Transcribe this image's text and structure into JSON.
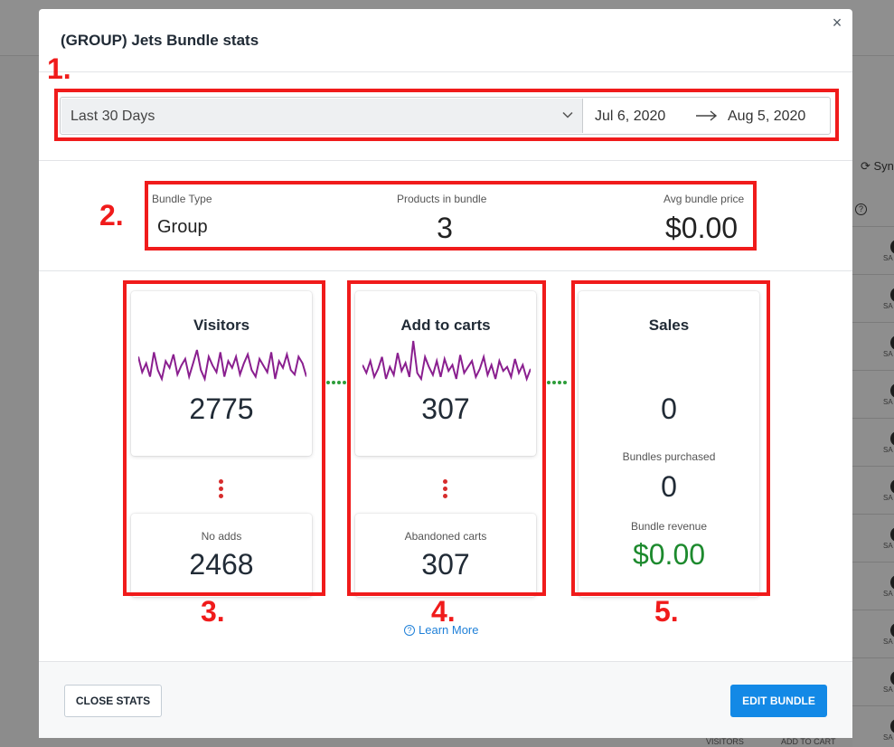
{
  "modal": {
    "title": "(GROUP) Jets Bundle stats",
    "close_glyph": "×"
  },
  "date_range": {
    "preset": "Last 30 Days",
    "start": "Jul 6, 2020",
    "end": "Aug 5, 2020"
  },
  "bundle_info": {
    "type_label": "Bundle Type",
    "type_value": "Group",
    "products_label": "Products in bundle",
    "products_value": "3",
    "price_label": "Avg bundle price",
    "price_value": "$0.00"
  },
  "funnel": {
    "visitors": {
      "title": "Visitors",
      "value": "2775",
      "sub_label": "No adds",
      "sub_value": "2468"
    },
    "add_to_carts": {
      "title": "Add to carts",
      "value": "307",
      "sub_label": "Abandoned carts",
      "sub_value": "307"
    },
    "sales": {
      "title": "Sales",
      "value": "0",
      "bundles_label": "Bundles purchased",
      "bundles_value": "0",
      "revenue_label": "Bundle revenue",
      "revenue_value": "$0.00"
    }
  },
  "sparklines": {
    "visitors": [
      12,
      5,
      9,
      3,
      14,
      6,
      2,
      10,
      7,
      13,
      4,
      8,
      11,
      3,
      9,
      15,
      6,
      2,
      12,
      8,
      5,
      14,
      3,
      10,
      7,
      12,
      4,
      9,
      13,
      6,
      3,
      11,
      8,
      5,
      14,
      2,
      10,
      7,
      13,
      6,
      4,
      12,
      9,
      3
    ],
    "add_to_carts": [
      10,
      6,
      12,
      4,
      8,
      14,
      3,
      9,
      5,
      16,
      7,
      11,
      4,
      22,
      6,
      3,
      14,
      9,
      5,
      12,
      4,
      13,
      7,
      10,
      3,
      15,
      6,
      9,
      12,
      4,
      8,
      14,
      5,
      10,
      3,
      12,
      7,
      9,
      4,
      13,
      6,
      10,
      3,
      8
    ]
  },
  "learn_more": "Learn More",
  "footer": {
    "close_label": "CLOSE STATS",
    "edit_label": "EDIT BUNDLE"
  },
  "annotations": [
    "1.",
    "2.",
    "3.",
    "4.",
    "5."
  ],
  "background": {
    "sync_label": "Syn",
    "row_label": "SA",
    "col_visitors": "VISITORS",
    "col_add_to_cart": "ADD TO CART"
  },
  "colors": {
    "sparkline": "#8a1f8f",
    "annotation": "#f01b1b",
    "revenue": "#1d8a2e",
    "connector": "#2d9d3a",
    "primary_button": "#1389e6"
  }
}
